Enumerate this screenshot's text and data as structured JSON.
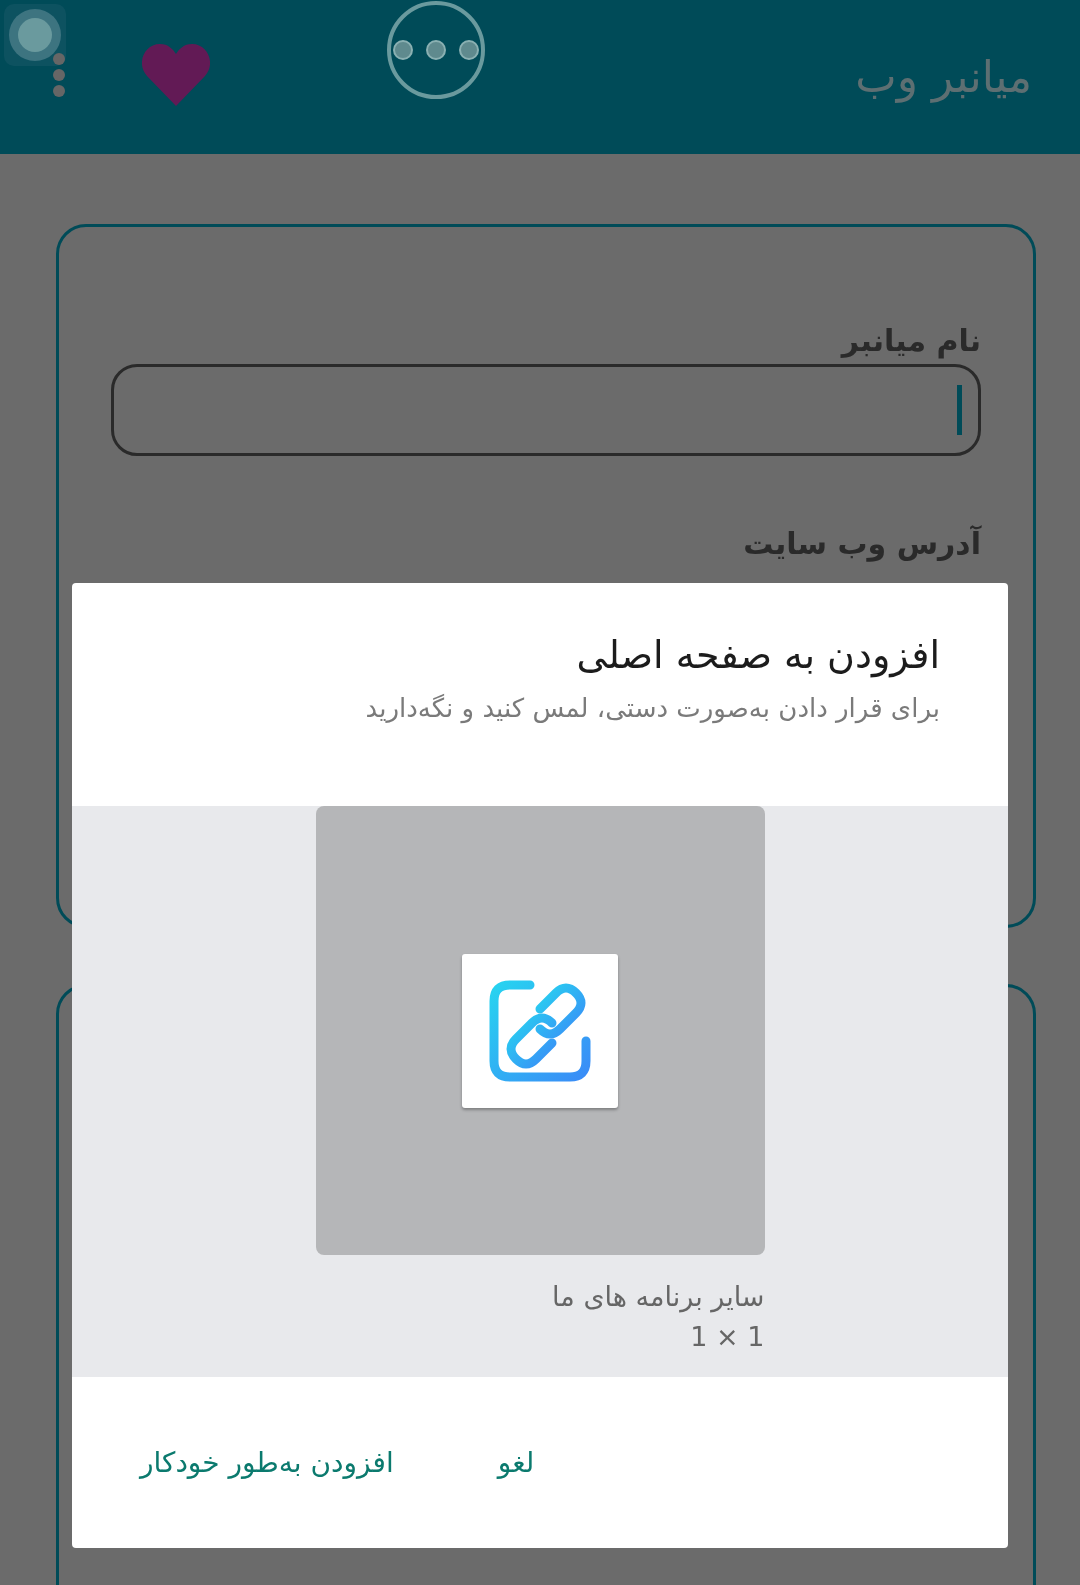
{
  "app_bar": {
    "title": "میانبر وب"
  },
  "form": {
    "name_field": {
      "label": "نام میانبر",
      "focused": true
    },
    "url_field": {
      "label": "آدرس وب سایت"
    }
  },
  "dialog": {
    "title": "افزودن به صفحه اصلی",
    "subtitle": "برای قرار دادن به‌صورت دستی، لمس کنید و نگه‌دارید",
    "preview": {
      "label": "سایر برنامه های ما",
      "size": "1 × 1"
    },
    "buttons": [
      {
        "label": "لغو"
      },
      {
        "label": "افزودن به‌طور خودکار"
      }
    ]
  }
}
